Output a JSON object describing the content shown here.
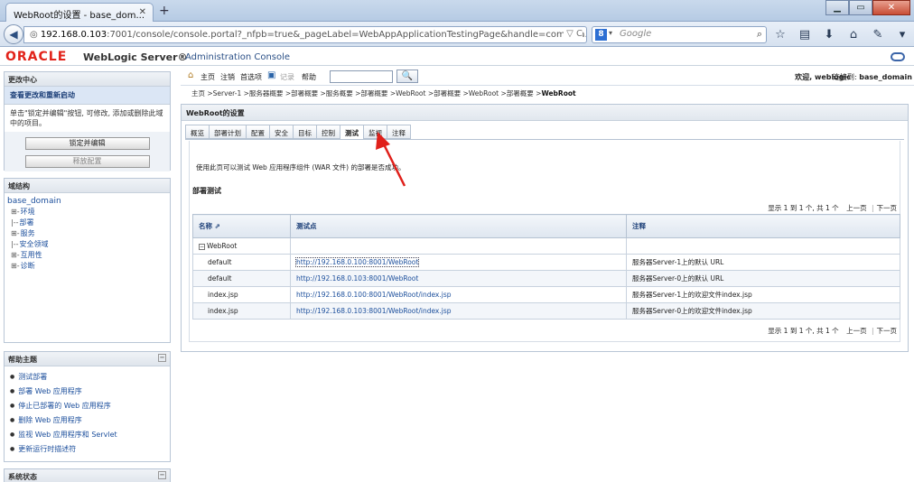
{
  "browser": {
    "tab_title": "WebRoot的设置 - base_dom...",
    "tab_close": "✕",
    "new_tab": "+",
    "url_host": "192.168.0.103",
    "url_rest": ":7001/console/console.portal?_nfpb=true&_pageLabel=WebAppApplicationTestingPage&handle=com.bea.console.har",
    "search_engine": "8",
    "search_placeholder": "Google",
    "win_min": "▁",
    "win_max": "▭",
    "win_close": "✕"
  },
  "header": {
    "logo": "ORACLE",
    "product": "WebLogic Server®",
    "subtitle": "Administration Console"
  },
  "change_center": {
    "title": "更改中心",
    "link": "查看更改和重新启动",
    "text": "单击\"锁定并编辑\"按钮, 可修改, 添加或删除此域中的项目。",
    "lock_button": "锁定并编辑",
    "release_button": "释放配置"
  },
  "domain_structure": {
    "title": "域结构",
    "root": "base_domain",
    "items": [
      {
        "prefix": "⊞-",
        "label": "环境"
      },
      {
        "prefix": "|--",
        "label": "部署"
      },
      {
        "prefix": "⊞-",
        "label": "服务"
      },
      {
        "prefix": "|--",
        "label": "安全领域"
      },
      {
        "prefix": "⊞-",
        "label": "互用性"
      },
      {
        "prefix": "⊞-",
        "label": "诊断"
      }
    ]
  },
  "help_topics": {
    "title": "帮助主题",
    "items": [
      "测试部署",
      "部署 Web 应用程序",
      "停止已部署的 Web 应用程序",
      "删除 Web 应用程序",
      "监视 Web 应用程序和 Servlet",
      "更新运行时描述符"
    ]
  },
  "system_status": {
    "title": "系统状态"
  },
  "toolbar": {
    "home": "主页",
    "logout": "注销",
    "preferences": "首选项",
    "record": "记录",
    "help": "帮助",
    "search_button": "🔍",
    "welcome": "欢迎, weblogic",
    "connected_label": "连接到:",
    "connected_domain": "base_domain"
  },
  "breadcrumb": "主页 >Server-1 >服务器概要 >部署概要 >服务概要 >部署概要 >WebRoot >部署概要 >WebRoot >部署概要 >",
  "breadcrumb_current": "WebRoot",
  "content": {
    "title": "WebRoot的设置",
    "tabs": [
      "概览",
      "部署计划",
      "配置",
      "安全",
      "目标",
      "控制",
      "测试",
      "监视",
      "注释"
    ],
    "active_tab": 6,
    "description": "使用此页可以测试 Web 应用程序组件 (WAR 文件) 的部署是否成功。",
    "section": "部署测试",
    "pager_info": "显示 1 到 1 个, 共 1 个",
    "pager_prev": "上一页",
    "pager_next": "下一页",
    "columns": [
      "名称 ⇗",
      "测试点",
      "注释"
    ],
    "group": {
      "toggle": "−",
      "name": "WebRoot"
    },
    "rows": [
      {
        "name": "default",
        "url": "http://192.168.0.100:8001/WebRoot",
        "note": "服务器Server-1上的默认 URL"
      },
      {
        "name": "default",
        "url": "http://192.168.0.103:8001/WebRoot",
        "note": "服务器Server-0上的默认 URL"
      },
      {
        "name": "index.jsp",
        "url": "http://192.168.0.100:8001/WebRoot/index.jsp",
        "note": "服务器Server-1上的欢迎文件index.jsp"
      },
      {
        "name": "index.jsp",
        "url": "http://192.168.0.103:8001/WebRoot/index.jsp",
        "note": "服务器Server-0上的欢迎文件index.jsp"
      }
    ]
  },
  "colors": {
    "annotation_arrow": "#e0201a",
    "oracle_red": "#e2231a",
    "link": "#1c4f9c"
  }
}
